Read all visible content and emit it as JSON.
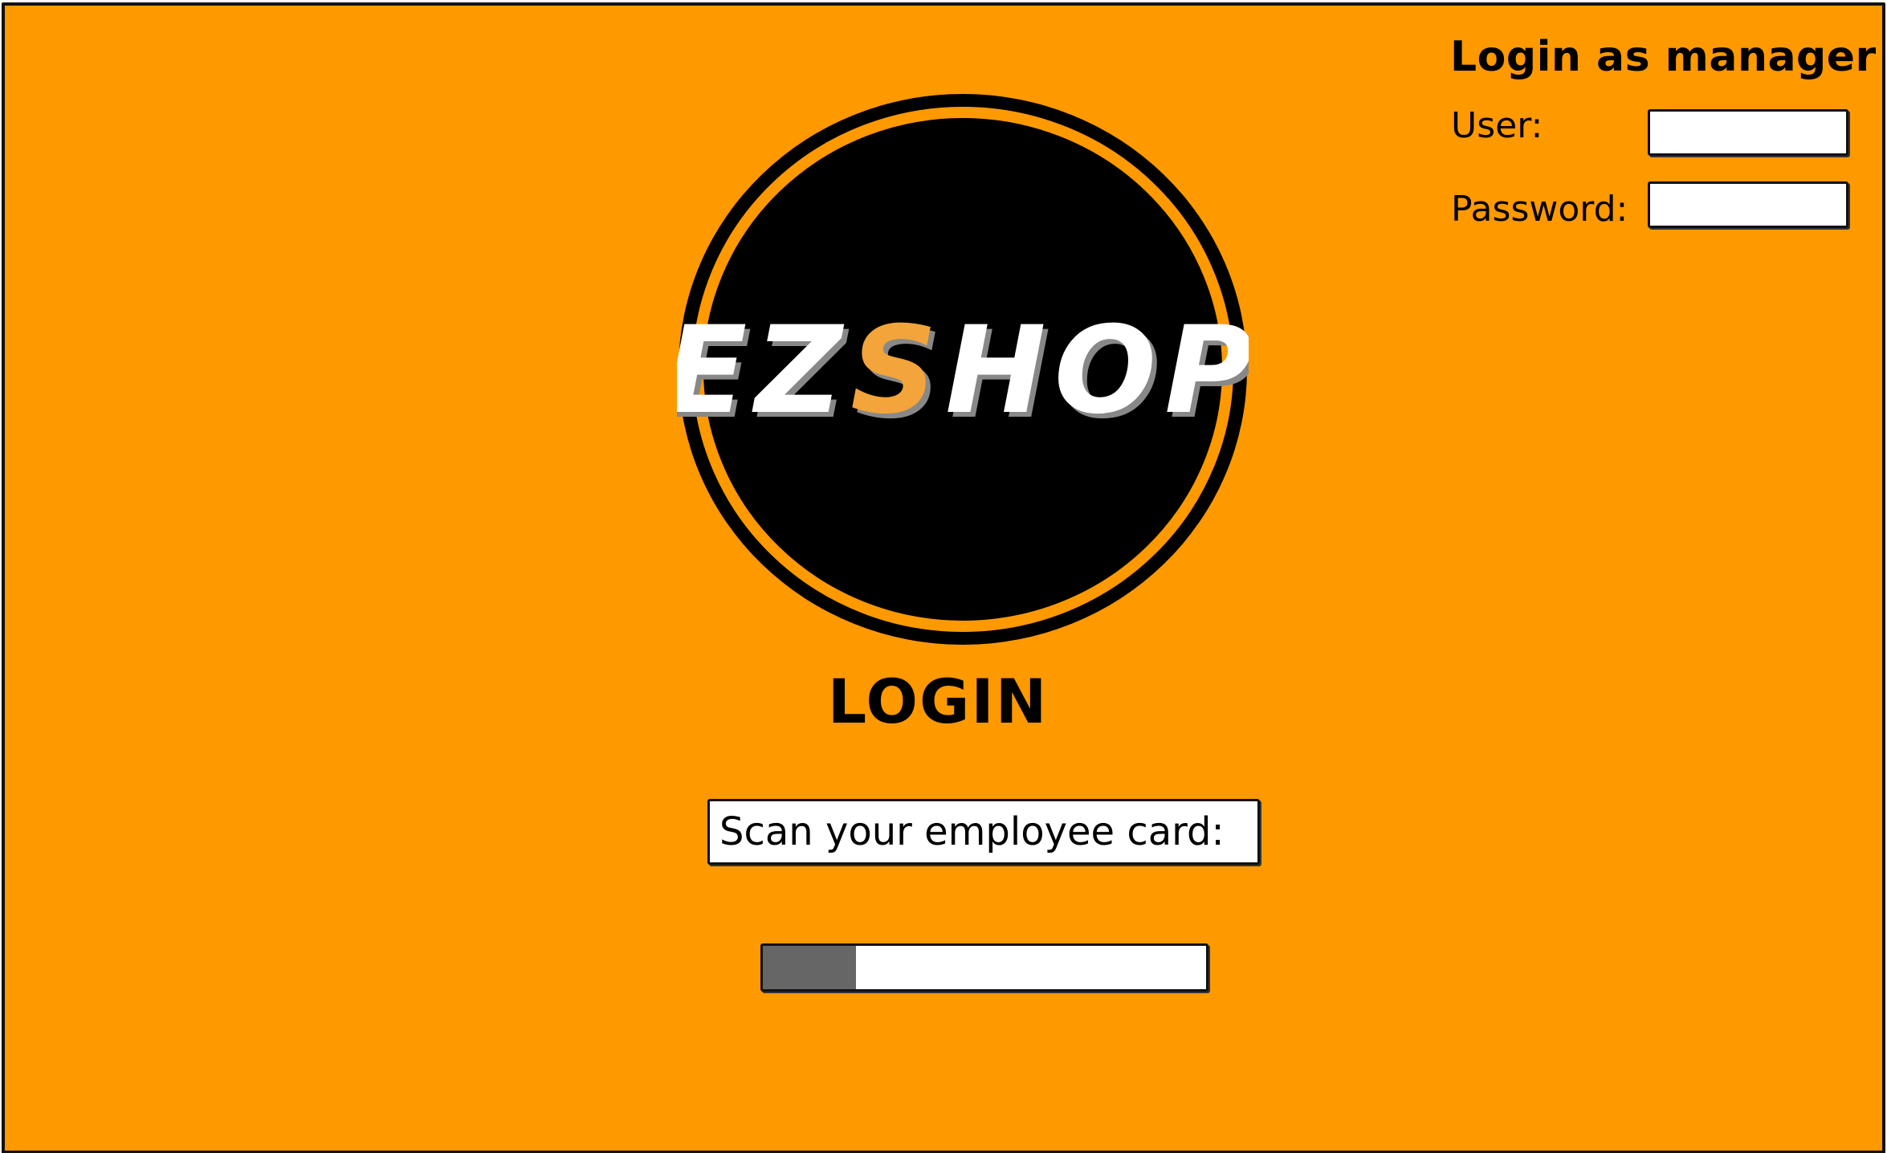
{
  "manager_login": {
    "title": "Login as manager",
    "user_label": "User:",
    "user_value": "",
    "password_label": "Password:",
    "password_value": ""
  },
  "logo": {
    "text_part1": "EZ",
    "text_part2": "S",
    "text_part3": "HOP",
    "highlight_color": "#F3A43B"
  },
  "main": {
    "heading": "LOGIN",
    "scan_prompt": "Scan your employee card:",
    "progress_fraction": 0.21
  },
  "colors": {
    "background": "#FF9900",
    "progress_fill": "#666666"
  }
}
